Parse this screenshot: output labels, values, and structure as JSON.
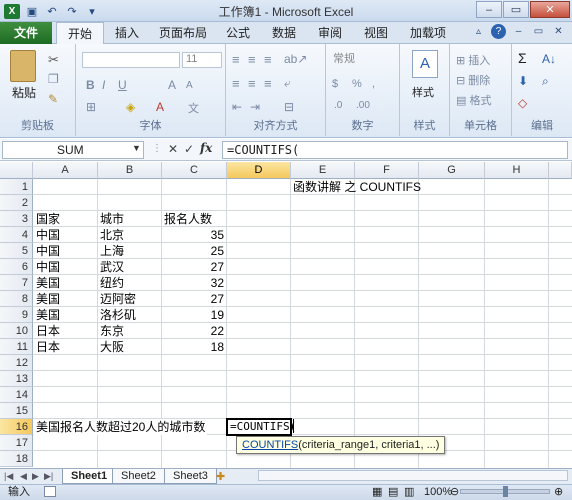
{
  "window": {
    "title": "工作簿1 - Microsoft Excel"
  },
  "ribbon": {
    "tabs": [
      "文件",
      "开始",
      "插入",
      "页面布局",
      "公式",
      "数据",
      "审阅",
      "视图",
      "加载项"
    ],
    "groups": {
      "clipboard": {
        "label": "剪贴板",
        "paste": "粘贴"
      },
      "font": {
        "label": "字体",
        "font_name": "",
        "font_size": "11",
        "bold": "B"
      },
      "alignment": {
        "label": "对齐方式"
      },
      "number": {
        "label": "数字",
        "format": "常规",
        "percent": "%"
      },
      "styles": {
        "label": "样式",
        "button": "样式"
      },
      "cells": {
        "label": "单元格",
        "insert": "插入",
        "delete": "删除",
        "format": "格式"
      },
      "editing": {
        "label": "编辑",
        "sum": "Σ"
      }
    }
  },
  "formula_bar": {
    "name_box": "SUM",
    "fx": "fx",
    "formula": "=COUNTIFS("
  },
  "sheet": {
    "columns": [
      "A",
      "B",
      "C",
      "D",
      "E",
      "F",
      "G",
      "H"
    ],
    "rows": [
      "1",
      "2",
      "3",
      "4",
      "5",
      "6",
      "7",
      "8",
      "9",
      "10",
      "11",
      "12",
      "13",
      "14",
      "15",
      "16",
      "17",
      "18"
    ],
    "heading": "函数讲解 之  COUNTIFS",
    "headers": {
      "country": "国家",
      "city": "城市",
      "count": "报名人数"
    },
    "data": [
      {
        "country": "中国",
        "city": "北京",
        "count": "35"
      },
      {
        "country": "中国",
        "city": "上海",
        "count": "25"
      },
      {
        "country": "中国",
        "city": "武汉",
        "count": "27"
      },
      {
        "country": "美国",
        "city": "纽约",
        "count": "32"
      },
      {
        "country": "美国",
        "city": "迈阿密",
        "count": "27"
      },
      {
        "country": "美国",
        "city": "洛杉矶",
        "count": "19"
      },
      {
        "country": "日本",
        "city": "东京",
        "count": "22"
      },
      {
        "country": "日本",
        "city": "大阪",
        "count": "18"
      }
    ],
    "question": "美国报名人数超过20人的城市数",
    "active_value": "=COUNTIFS(",
    "tooltip": {
      "fn": "COUNTIFS",
      "args": "(criteria_range1, criteria1, ...)"
    }
  },
  "sheets": [
    "Sheet1",
    "Sheet2",
    "Sheet3"
  ],
  "status": {
    "mode": "输入",
    "zoom": "100%"
  }
}
